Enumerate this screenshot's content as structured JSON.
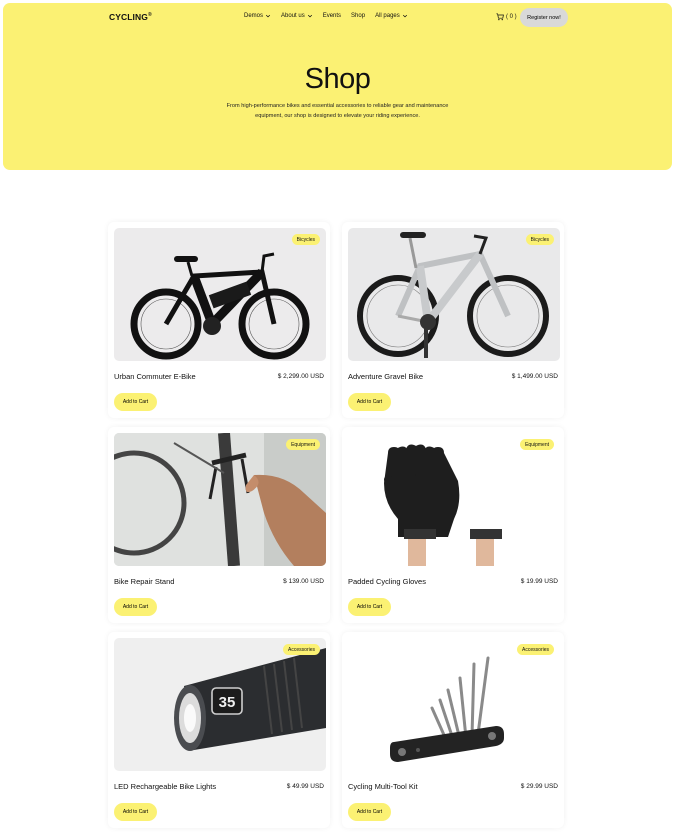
{
  "header": {
    "logo": "CYCLING",
    "logo_mark": "®",
    "nav": [
      {
        "label": "Demos",
        "has_dropdown": true
      },
      {
        "label": "About us",
        "has_dropdown": true
      },
      {
        "label": "Events",
        "has_dropdown": false
      },
      {
        "label": "Shop",
        "has_dropdown": false
      },
      {
        "label": "All pages",
        "has_dropdown": true
      }
    ],
    "cart_count": "( 0 )",
    "register_label": "Register now!"
  },
  "hero": {
    "title": "Shop",
    "description": "From high-performance bikes and essential accessories to reliable gear and maintenance equipment, our shop is designed to elevate your riding experience."
  },
  "products": [
    {
      "name": "Urban Commuter E-Bike",
      "price": "$ 2,299.00 USD",
      "category": "Bicycles",
      "button": "Add to Cart"
    },
    {
      "name": "Adventure Gravel Bike",
      "price": "$ 1,499.00 USD",
      "category": "Bicycles",
      "button": "Add to Cart"
    },
    {
      "name": "Bike Repair Stand",
      "price": "$ 139.00 USD",
      "category": "Equipment",
      "button": "Add to Cart"
    },
    {
      "name": "Padded Cycling Gloves",
      "price": "$ 19.99 USD",
      "category": "Equipment",
      "button": "Add to Cart"
    },
    {
      "name": "LED Rechargeable Bike Lights",
      "price": "$ 49.99 USD",
      "category": "Accessories",
      "button": "Add to Cart"
    },
    {
      "name": "Cycling Multi-Tool Kit",
      "price": "$ 29.99 USD",
      "category": "Accessories",
      "button": "Add to Cart"
    }
  ],
  "flashlight_number": "35",
  "colors": {
    "accent": "#fbf173",
    "button_gray": "#d9d9d9",
    "text": "#111111"
  }
}
